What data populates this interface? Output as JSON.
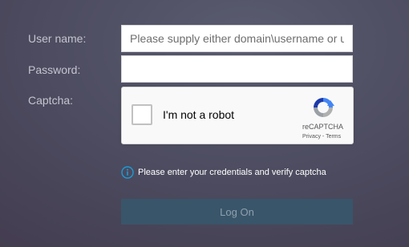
{
  "form": {
    "username_label": "User name:",
    "username_placeholder": "Please supply either domain\\username or user@",
    "username_value": "",
    "password_label": "Password:",
    "password_value": "",
    "captcha_label": "Captcha:"
  },
  "captcha": {
    "checkbox_label": "I'm not a robot",
    "checked": false,
    "brand": "reCAPTCHA",
    "privacy_link": "Privacy",
    "separator": " - ",
    "terms_link": "Terms",
    "icon": "recaptcha-logo-icon"
  },
  "info": {
    "icon": "info-circle-icon",
    "message": "Please enter your credentials and verify captcha"
  },
  "actions": {
    "logon_label": "Log On"
  },
  "colors": {
    "accent": "#1c9bd6",
    "logon_background": "#39556a",
    "logon_text": "#8fa0ad",
    "label_text": "#c4c4d0"
  }
}
